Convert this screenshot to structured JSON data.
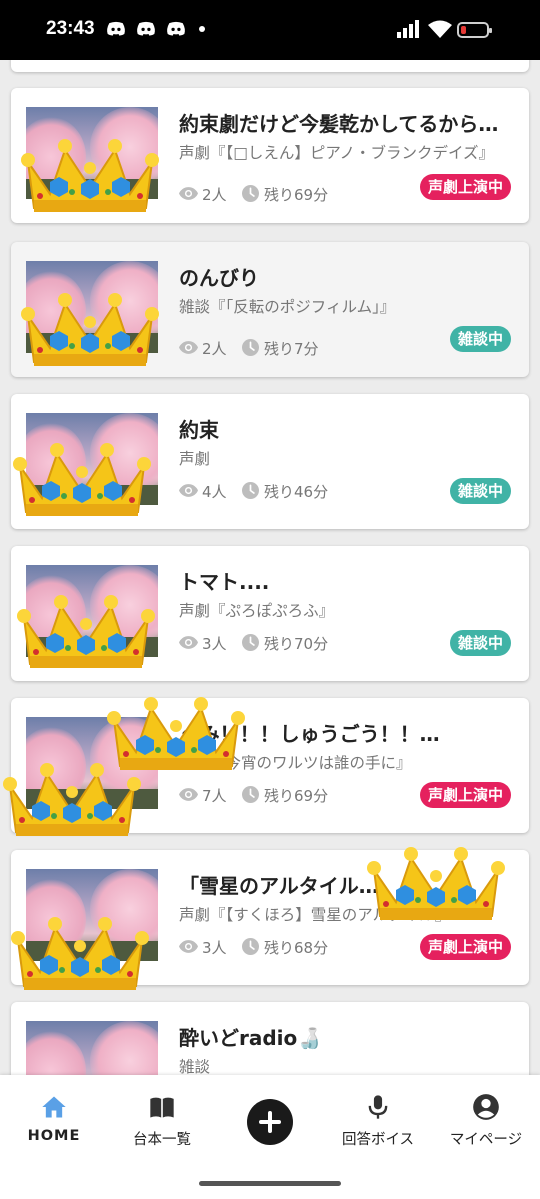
{
  "status_bar": {
    "time": "23:43"
  },
  "cards": [
    {
      "title": "約束劇だけど今髪乾かしてるから…",
      "genre": "声劇『【□しえん】ピアノ・ブランクデイズ』",
      "viewers": "2人",
      "remaining": "残り69分",
      "badge": "声劇上演中",
      "badge_color": "#e5215e"
    },
    {
      "title": "のんびり",
      "genre": "雑談『「反転のポジフィルム」』",
      "viewers": "2人",
      "remaining": "残り7分",
      "badge": "雑談中",
      "badge_color": "#40b3a6"
    },
    {
      "title": "約束",
      "genre": "声劇",
      "viewers": "4人",
      "remaining": "残り46分",
      "badge": "雑談中",
      "badge_color": "#40b3a6"
    },
    {
      "title": "トマト....",
      "genre": "声劇『ぷろぽぷろふ』",
      "viewers": "3人",
      "remaining": "残り70分",
      "badge": "雑談中",
      "badge_color": "#40b3a6"
    },
    {
      "title": "ぐみ！！！しゅうごう！！…",
      "genre": "声劇『今宵のワルツは誰の手に』",
      "viewers": "7人",
      "remaining": "残り69分",
      "badge": "声劇上演中",
      "badge_color": "#e5215e"
    },
    {
      "title": "「雪星のアルタイル…",
      "genre": "声劇『【すくほろ】雪星のアルタイル』",
      "viewers": "3人",
      "remaining": "残り68分",
      "badge": "声劇上演中",
      "badge_color": "#e5215e"
    },
    {
      "title": "酔いどradio🍶",
      "genre": "雑談"
    }
  ],
  "bottom_nav": [
    {
      "label": "HOME",
      "icon": "home-icon",
      "active": true
    },
    {
      "label": "台本一覧",
      "icon": "book-icon"
    },
    {
      "label": "",
      "icon": "plus-icon"
    },
    {
      "label": "回答ボイス",
      "icon": "microphone-icon"
    },
    {
      "label": "マイページ",
      "icon": "account-circle-icon"
    }
  ],
  "colors": {
    "accent_home": "#5aa0e6",
    "badge_red": "#e5215e",
    "badge_teal": "#40b3a6"
  }
}
